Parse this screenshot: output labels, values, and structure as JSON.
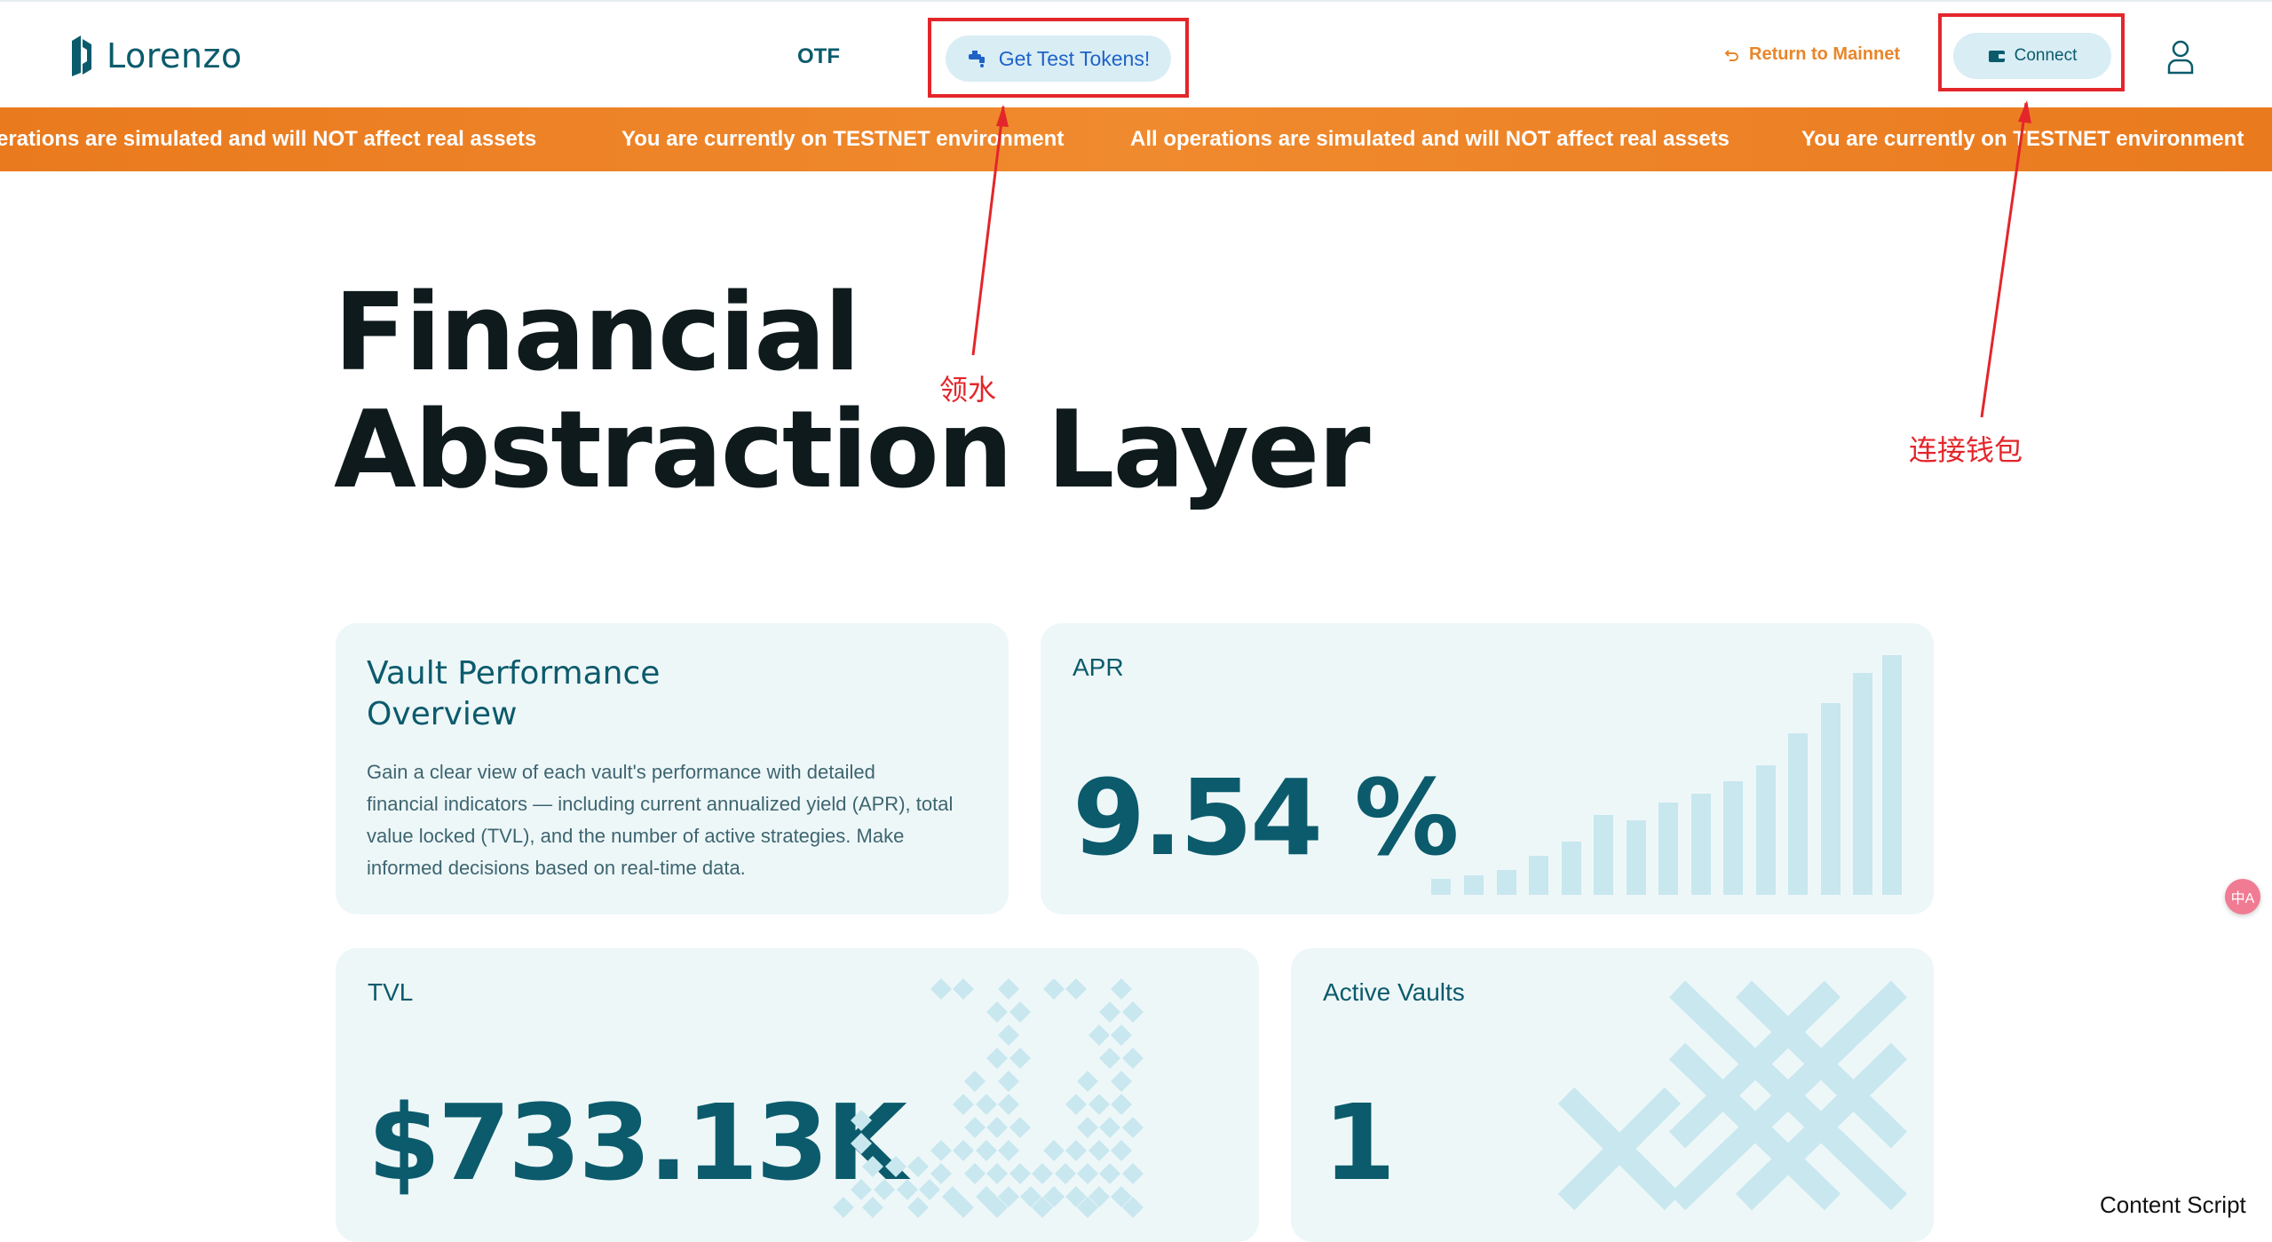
{
  "header": {
    "logo_text": "Lorenzo",
    "nav_otf": "OTF",
    "test_tokens_label": "Get Test Tokens!",
    "return_label": "Return to Mainnet",
    "connect_label": "Connect"
  },
  "banner": {
    "messages": [
      "erations are simulated and will NOT affect real assets",
      "You are currently on TESTNET environment",
      "All operations are simulated and will NOT affect real assets",
      "You are currently on TESTNET environment"
    ]
  },
  "hero": {
    "line1": "Financial",
    "line2": "Abstraction Layer"
  },
  "annotations": {
    "faucet": "领水",
    "connect_wallet": "连接钱包"
  },
  "vault_overview": {
    "title_line1": "Vault Performance",
    "title_line2": "Overview",
    "description_lines": [
      "Gain a clear view of each vault's performance with detailed",
      "financial indicators — including current annualized yield (APR), total",
      "value locked (TVL), and the number of active strategies. Make",
      "informed decisions based on real-time data."
    ]
  },
  "apr": {
    "label": "APR",
    "value": "9.54 %"
  },
  "tvl": {
    "label": "TVL",
    "value": "$733.13K"
  },
  "active_vaults": {
    "label": "Active Vaults",
    "value": "1"
  },
  "overlay": {
    "content_script": "Content Script",
    "translate_icon": "中A"
  },
  "colors": {
    "primary": "#0b5b6c",
    "banner": "#ec8124",
    "card_bg": "#eef7f8",
    "decor": "#c8e7ef",
    "annotation": "#e3262b"
  }
}
